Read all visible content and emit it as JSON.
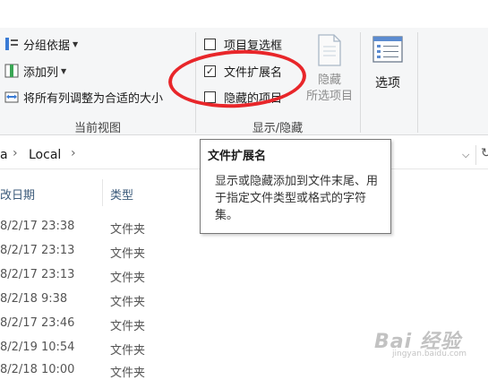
{
  "ribbon": {
    "layout": {
      "group_by": "分组依据",
      "add_column": "添加列",
      "size_all": "将所有列调整为合适的大小",
      "label": "当前视图"
    },
    "show_hide": {
      "checkbox_items": "项目复选框",
      "file_extensions": "文件扩展名",
      "hidden_items": "隐藏的项目",
      "hide_selected_line1": "隐藏",
      "hide_selected_line2": "所选项目",
      "label": "显示/隐藏",
      "file_extensions_checked": true,
      "checkbox_items_checked": false,
      "hidden_items_checked": false
    },
    "options": {
      "label": "选项"
    }
  },
  "address": {
    "prefix": "a",
    "crumb": "Local",
    "sep": "›"
  },
  "columns": {
    "date": "改日期",
    "type": "类型"
  },
  "rows": [
    {
      "date": "8/2/17 23:38",
      "type": "文件夹"
    },
    {
      "date": "8/2/17 23:13",
      "type": "文件夹"
    },
    {
      "date": "8/2/17 23:13",
      "type": "文件夹"
    },
    {
      "date": "8/2/18 9:38",
      "type": "文件夹"
    },
    {
      "date": "8/2/17 23:46",
      "type": "文件夹"
    },
    {
      "date": "8/2/19 10:54",
      "type": "文件夹"
    },
    {
      "date": "8/2/18 10:00",
      "type": "文件夹"
    }
  ],
  "tooltip": {
    "title": "文件扩展名",
    "body": "显示或隐藏添加到文件末尾、用于指定文件类型或格式的字符集。"
  },
  "watermark": {
    "main": "Bai 经验",
    "sub": "jingyan.baidu.com"
  },
  "colors": {
    "ring": "#e8262a",
    "tooltip_border": "#767676"
  }
}
